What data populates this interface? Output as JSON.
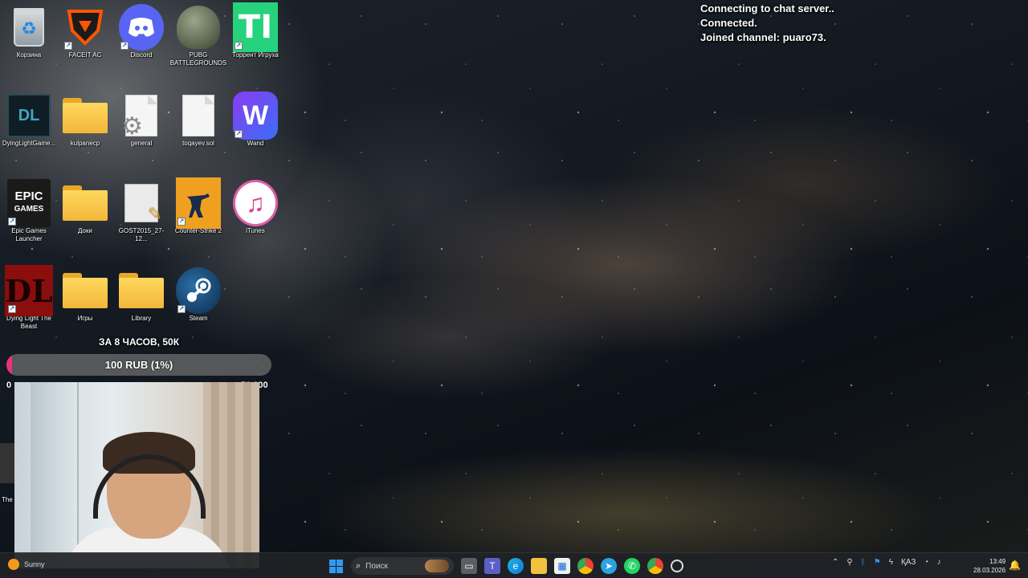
{
  "chat": {
    "lines": [
      "Connecting to chat server..",
      "Connected.",
      "Joined channel: puaro73."
    ]
  },
  "desktop": {
    "icons": [
      {
        "label": "Корзина",
        "icon": "recycle-bin-icon"
      },
      {
        "label": "FACEIT AC",
        "icon": "faceit-icon"
      },
      {
        "label": "Discord",
        "icon": "discord-icon"
      },
      {
        "label": "PUBG BATTLEGROUNDS",
        "icon": "pubg-icon"
      },
      {
        "label": "Торрент Игруха",
        "icon": "torrent-icon"
      },
      {
        "label": "DyingLightGame...",
        "icon": "dying-light-game-icon"
      },
      {
        "label": "kulpanecp",
        "icon": "folder-icon"
      },
      {
        "label": "general",
        "icon": "settings-file-icon"
      },
      {
        "label": "toqayev.sol",
        "icon": "file-icon"
      },
      {
        "label": "Wand",
        "icon": "wand-icon"
      },
      {
        "label": "Epic Games Launcher",
        "icon": "epic-games-icon"
      },
      {
        "label": "Доки",
        "icon": "folder-icon"
      },
      {
        "label": "GOST2015_27-12...",
        "icon": "document-icon"
      },
      {
        "label": "Counter-Strike 2",
        "icon": "counter-strike-icon"
      },
      {
        "label": "iTunes",
        "icon": "itunes-icon"
      },
      {
        "label": "Dying Light The Beast",
        "icon": "dying-light-beast-icon"
      },
      {
        "label": "Игры",
        "icon": "folder-icon"
      },
      {
        "label": "Library",
        "icon": "folder-icon"
      },
      {
        "label": "Steam",
        "icon": "steam-icon"
      },
      {
        "label": "The",
        "icon": "partial-icon"
      }
    ],
    "epic_logo_top": "EPIC",
    "epic_logo_bottom": "GAMES",
    "torrent_logo": "TI",
    "dl_logo": "DL",
    "wand_logo": "W"
  },
  "donation_goal": {
    "title": "ЗА 8 ЧАСОВ, 50К",
    "progress_text": "100 RUB (1%)",
    "progress_fraction": 0.01,
    "min_label": "0",
    "max_label": "50 000",
    "fill_color": "#e8327c"
  },
  "taskbar": {
    "weather_text": "Sunny",
    "search_placeholder": "Поиск",
    "language": "ҚАЗ",
    "time": "13:49",
    "date": "28.03.2026",
    "apps": [
      "task-view-icon",
      "teams-icon",
      "edge-icon",
      "file-explorer-icon",
      "store-icon",
      "chrome-icon",
      "telegram-icon",
      "whatsapp-icon",
      "chrome-alt-icon",
      "obs-icon"
    ]
  }
}
